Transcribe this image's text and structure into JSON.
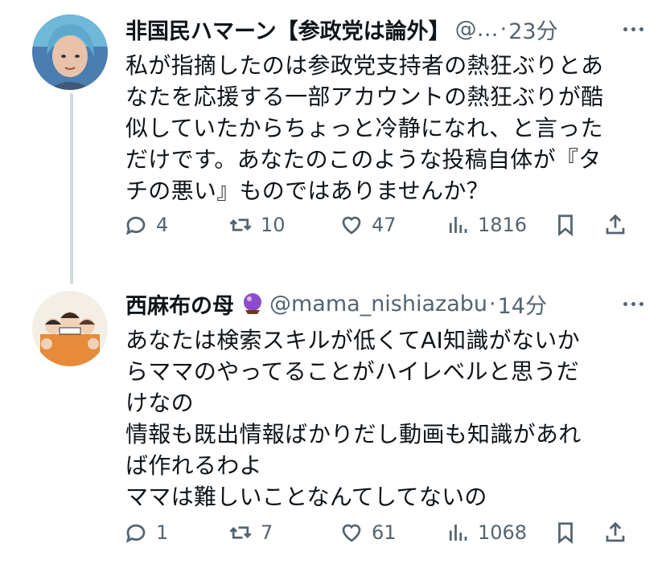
{
  "tweets": [
    {
      "display_name": "非国民ハマーン【参政党は論外】",
      "handle": "@…",
      "separator": "·",
      "time": "23分",
      "body": "私が指摘したのは参政党支持者の熱狂ぶりとあ\nなたを応援する一部アカウントの熱狂ぶりが酷\n似していたからちょっと冷静になれ、と言った\nだけです。あなたのこのような投稿自体が『タ\nチの悪い』ものではありませんか？",
      "replies": "4",
      "retweets": "10",
      "likes": "47",
      "views": "1816",
      "avatar_icon": "anime-portrait-avatar"
    },
    {
      "display_name": "西麻布の母",
      "badge_icon": "crystal-ball-icon",
      "handle": "@mama_nishiazabu",
      "separator": "·",
      "time": "14分",
      "body": "あなたは検索スキルが低くてAI知識がないか\nらママのやってることがハイレベルと思うだ\nけなの\n情報も既出情報ばかりだし動画も知識があれ\nば作れるわよ\nママは難しいことなんてしてないの",
      "replies": "1",
      "retweets": "7",
      "likes": "61",
      "views": "1068",
      "avatar_icon": "group-illustration-avatar"
    }
  ],
  "colors": {
    "text": "#0f1419",
    "secondary": "#536471",
    "thread_line": "#cfd9de"
  },
  "icons": [
    "reply-icon",
    "retweet-icon",
    "like-icon",
    "views-icon",
    "bookmark-icon",
    "share-icon",
    "more-icon"
  ]
}
